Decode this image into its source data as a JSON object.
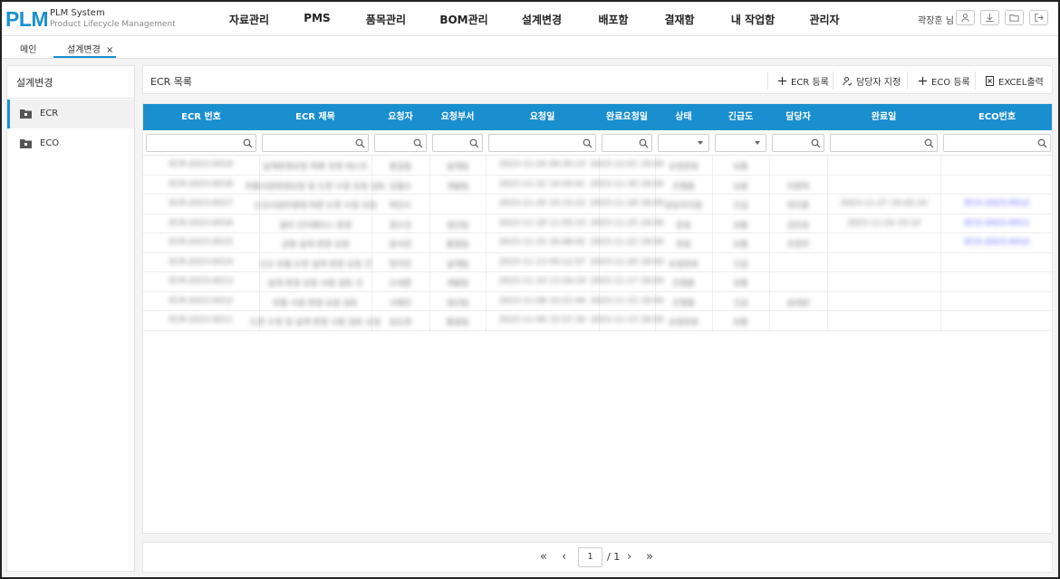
{
  "logo": {
    "mark": "PLM",
    "title": "PLM System",
    "subtitle": "Product Lifecycle Management"
  },
  "nav": [
    "자료관리",
    "PMS",
    "품목관리",
    "BOM관리",
    "설계변경",
    "배포함",
    "결재함",
    "내 작업함",
    "관리자"
  ],
  "user": {
    "name": "곽장훈 님"
  },
  "header_icons": [
    "user-icon",
    "download-icon",
    "folder-icon",
    "logout-icon"
  ],
  "tabs": [
    {
      "label": "메인",
      "active": false
    },
    {
      "label": "설계변경",
      "active": true,
      "close": "×"
    }
  ],
  "sidebar": {
    "title": "설계변경",
    "items": [
      {
        "label": "ECR",
        "active": true,
        "icon": "folder-icon"
      },
      {
        "label": "ECO",
        "active": false,
        "icon": "folder-icon"
      }
    ]
  },
  "main": {
    "title": "ECR 목록",
    "toolbar": [
      {
        "label": "ECR 등록",
        "icon": "plus-icon"
      },
      {
        "label": "담당자 지정",
        "icon": "user-assign-icon"
      },
      {
        "label": "ECO 등록",
        "icon": "plus-icon"
      },
      {
        "label": "EXCEL출력",
        "icon": "excel-icon"
      }
    ]
  },
  "table": {
    "columns": [
      "ECR 번호",
      "ECR 제목",
      "요청자",
      "요청부서",
      "요청일",
      "완료요청일",
      "상태",
      "긴급도",
      "담당자",
      "완료일",
      "ECO번호"
    ],
    "filters": [
      "search",
      "search",
      "search",
      "search",
      "search",
      "search",
      "select",
      "select",
      "search",
      "search",
      "search"
    ],
    "rows": [
      [
        "ECR-2023-0019",
        "설계변경요청 목록 조회 테스트",
        "홍길동",
        "설계팀",
        "2023-11-24 09:30:15",
        "2023-12-01 18:00",
        "요청완료",
        "보통",
        "",
        "",
        ""
      ],
      [
        "ECR-2023-0018",
        "부품사양변경요청 및 도면 수정 요청 검토",
        "김철수",
        "개발팀",
        "2023-11-22 14:20:41",
        "2023-11-30 18:00",
        "진행중",
        "낮음",
        "이영희",
        "",
        ""
      ],
      [
        "ECR-2023-0017",
        "신규사양반영에 따른 도면 수정 요청",
        "박민수",
        "",
        "2023-11-20 10:15:22",
        "2023-11-28 18:00",
        "담당자지정",
        "긴급",
        "최지훈",
        "2023-11-27 16:42:10",
        "ECO-2023-0012"
      ],
      [
        "ECR-2023-0016",
        "설비 인터페이스 변경",
        "정수진",
        "생산팀",
        "2023-11-18 11:05:33",
        "2023-11-25 18:00",
        "완료",
        "보통",
        "강민호",
        "2023-11-24 15:10",
        "ECO-2023-0011"
      ],
      [
        "ECR-2023-0015",
        "금형 설계 변경 요청",
        "윤서연",
        "품질팀",
        "2023-11-15 16:48:02",
        "2023-11-22 18:00",
        "완료",
        "보통",
        "조현우",
        "",
        "ECO-2023-0010"
      ],
      [
        "ECR-2023-0014",
        "신규 모델 도면 설계 변경 요청 건",
        "한지민",
        "설계팀",
        "2023-11-13 09:12:57",
        "2023-11-20 18:00",
        "요청완료",
        "긴급",
        "",
        "",
        ""
      ],
      [
        "ECR-2023-0013",
        "설계 변경 요청 사항 검토 건",
        "오세훈",
        "개발팀",
        "2023-11-10 13:34:19",
        "2023-11-17 18:00",
        "진행중",
        "보통",
        "",
        "",
        ""
      ],
      [
        "ECR-2023-0012",
        "부품 사양 변경 요청 검토",
        "서예진",
        "생산팀",
        "2023-11-08 10:21:44",
        "2023-11-15 18:00",
        "진행중",
        "긴급",
        "송태양",
        "",
        ""
      ],
      [
        "ECR-2023-0011",
        "도면 수정 및 설계 변경 사항 검토 요청",
        "임도현",
        "품질팀",
        "2023-11-06 15:57:30",
        "2023-11-13 18:00",
        "요청완료",
        "보통",
        "",
        "",
        ""
      ]
    ]
  },
  "pager": {
    "first": "«",
    "prev": "‹",
    "current": "1",
    "total": "/ 1",
    "next": "›",
    "last": "»"
  }
}
